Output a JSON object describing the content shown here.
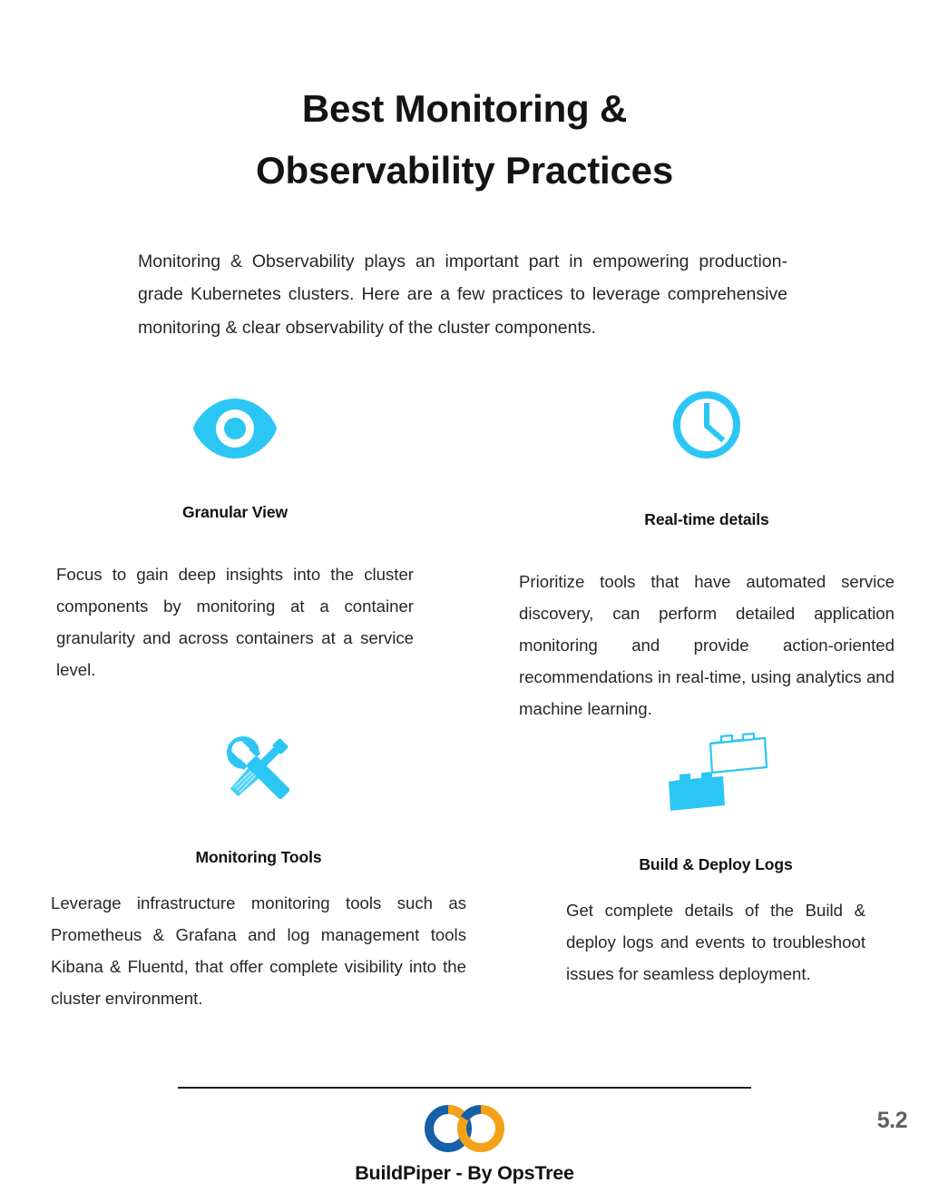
{
  "document": {
    "title_line1": "Best Monitoring &",
    "title_line2": "Observability Practices",
    "intro": "Monitoring & Observability plays an important part in empowering production-grade Kubernetes clusters. Here are a few practices to leverage comprehensive monitoring & clear observability of the cluster components."
  },
  "colors": {
    "accent_cyan": "#2CC6F5",
    "logo_blue": "#1560A8",
    "logo_orange": "#F5A117",
    "heading_black": "#111111",
    "body_gray": "#272727",
    "page_number_gray": "#5d6163"
  },
  "cards": [
    {
      "icon": "eye-icon",
      "heading": "Granular View",
      "body": "Focus to gain deep insights into the cluster components by monitoring at a container granularity and across containers at a service level."
    },
    {
      "icon": "clock-icon",
      "heading": "Real-time details",
      "body": "Prioritize tools that have automated service discovery, can perform detailed application monitoring and provide action-oriented recommendations in real-time, using analytics and machine learning."
    },
    {
      "icon": "tools-icon",
      "heading": "Monitoring Tools",
      "body": "Leverage infrastructure monitoring tools such as Prometheus & Grafana and log management tools Kibana & Fluentd, that offer complete visibility into the cluster environment."
    },
    {
      "icon": "lego-bricks-icon",
      "heading": "Build & Deploy Logs",
      "body": "Get complete details of the Build & deploy logs and events to troubleshoot issues for seamless deployment."
    }
  ],
  "footer": {
    "brand": "BuildPiper - By OpsTree",
    "logo_icon": "buildpiper-infinity-rings-logo",
    "page_number": "5.2"
  }
}
